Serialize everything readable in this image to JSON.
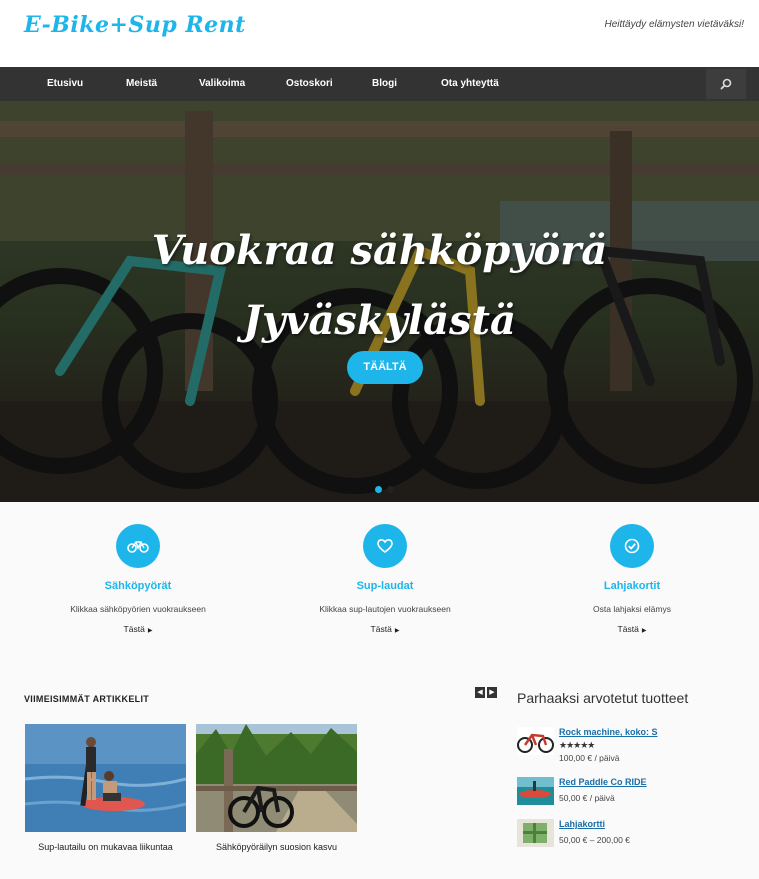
{
  "site": {
    "logo": "E-Bike+Sup Rent",
    "tagline": "Heittäydy elämysten vietäväksi!"
  },
  "nav": {
    "items": [
      "Etusivu",
      "Meistä",
      "Valikoima",
      "Ostoskori",
      "Blogi",
      "Ota yhteyttä"
    ]
  },
  "hero": {
    "title_line1": "Vuokraa sähköpyörä",
    "title_line2": "Jyväskylästä",
    "button_label": "TÄÄLTÄ",
    "slide_count": 2,
    "active_slide": 1
  },
  "features": [
    {
      "icon": "bicycle-icon",
      "title": "Sähköpyörät",
      "desc": "Klikkaa sähköpyörien vuokraukseen",
      "link": "Tästä"
    },
    {
      "icon": "heart-icon",
      "title": "Sup-laudat",
      "desc": "Klikkaa sup-lautojen vuokraukseen",
      "link": "Tästä"
    },
    {
      "icon": "check-circle-icon",
      "title": "Lahjakortit",
      "desc": "Osta lahjaksi elämys",
      "link": "Tästä"
    }
  ],
  "articles": {
    "heading": "VIIMEISIMMÄT ARTIKKELIT",
    "posts": [
      {
        "caption": "Sup-lautailu on mukavaa liikuntaa"
      },
      {
        "caption": "Sähköpyöräilyn suosion kasvu"
      }
    ]
  },
  "top_rated": {
    "heading": "Parhaaksi arvotetut tuotteet",
    "products": [
      {
        "name": "Rock machine, koko: S",
        "stars": "★★★★★",
        "rating": 5,
        "price": "100,00 € / päivä"
      },
      {
        "name": "Red Paddle Co RIDE",
        "price": "50,00 € / päivä"
      },
      {
        "name": "Lahjakortti",
        "price": "50,00 € – 200,00 €"
      }
    ]
  },
  "colors": {
    "accent": "#1eb6ea",
    "nav_bg": "#333333",
    "link": "#1a6fa8"
  }
}
